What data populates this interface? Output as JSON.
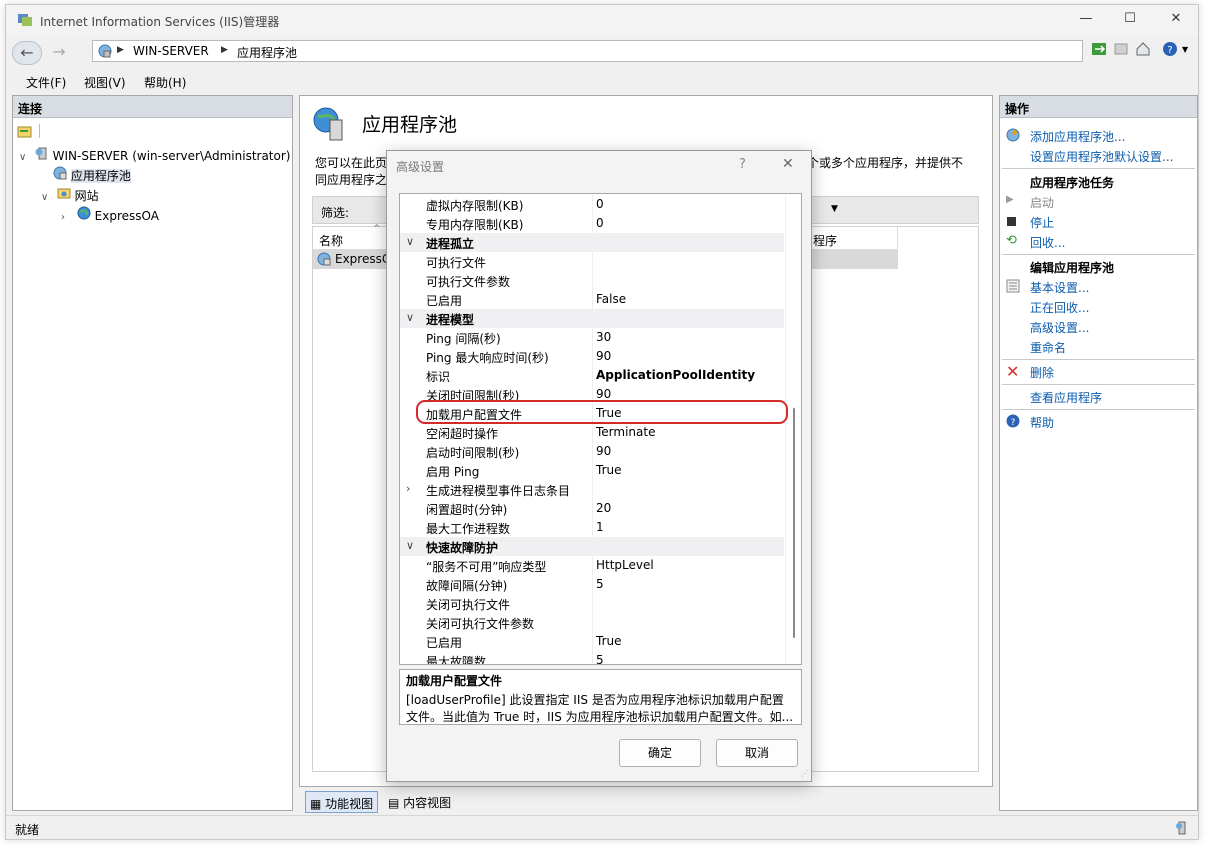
{
  "window": {
    "title": "Internet Information Services (IIS)管理器",
    "minimize": "—",
    "maximize": "☐",
    "close": "✕"
  },
  "address": {
    "segments": [
      "WIN-SERVER",
      "应用程序池"
    ]
  },
  "menu": [
    "文件(F)",
    "视图(V)",
    "帮助(H)"
  ],
  "connections": {
    "title": "连接",
    "tree": [
      {
        "label": "WIN-SERVER (win-server\\Administrator)",
        "toggle": "∨"
      },
      {
        "label": "应用程序池"
      },
      {
        "label": "网站",
        "toggle": "∨"
      },
      {
        "label": "ExpressOA",
        "toggle": "›"
      }
    ]
  },
  "main": {
    "title": "应用程序池",
    "desc_line1": "您可以在此页",
    "desc_line1_tail": "个或多个应用程序，并提供不",
    "desc_line2": "同应用程序之",
    "filter_label": "筛选:",
    "col_name": "名称",
    "col_app": "程序",
    "row_name": "ExpressC"
  },
  "bottom_tabs": [
    "功能视图",
    "内容视图"
  ],
  "actions": {
    "title": "操作",
    "add_pool": "添加应用程序池...",
    "set_defaults": "设置应用程序池默认设置...",
    "tasks_header": "应用程序池任务",
    "start": "启动",
    "stop": "停止",
    "recycle": "回收...",
    "edit_header": "编辑应用程序池",
    "basic": "基本设置...",
    "recycling": "正在回收...",
    "advanced": "高级设置...",
    "rename": "重命名",
    "delete": "删除",
    "view_apps": "查看应用程序",
    "help": "帮助"
  },
  "status": {
    "text": "就绪"
  },
  "dialog": {
    "title": "高级设置",
    "help": "?",
    "close": "✕",
    "rows": [
      {
        "name": "虚拟内存限制(KB)",
        "value": "0"
      },
      {
        "name": "专用内存限制(KB)",
        "value": "0"
      },
      {
        "name": "进程孤立",
        "value": "",
        "category": true,
        "glyph": "∨"
      },
      {
        "name": "可执行文件",
        "value": ""
      },
      {
        "name": "可执行文件参数",
        "value": ""
      },
      {
        "name": "已启用",
        "value": "False"
      },
      {
        "name": "进程模型",
        "value": "",
        "category": true,
        "glyph": "∨"
      },
      {
        "name": "Ping 间隔(秒)",
        "value": "30"
      },
      {
        "name": "Ping 最大响应时间(秒)",
        "value": "90"
      },
      {
        "name": "标识",
        "value": "ApplicationPoolIdentity",
        "bold": true
      },
      {
        "name": "关闭时间限制(秒)",
        "value": "90"
      },
      {
        "name": "加载用户配置文件",
        "value": "True",
        "highlight": true
      },
      {
        "name": "空闲超时操作",
        "value": "Terminate"
      },
      {
        "name": "启动时间限制(秒)",
        "value": "90"
      },
      {
        "name": "启用 Ping",
        "value": "True"
      },
      {
        "name": "生成进程模型事件日志条目",
        "value": "",
        "glyph": "›"
      },
      {
        "name": "闲置超时(分钟)",
        "value": "20"
      },
      {
        "name": "最大工作进程数",
        "value": "1"
      },
      {
        "name": "快速故障防护",
        "value": "",
        "category": true,
        "glyph": "∨"
      },
      {
        "name": "“服务不可用”响应类型",
        "value": "HttpLevel"
      },
      {
        "name": "故障间隔(分钟)",
        "value": "5"
      },
      {
        "name": "关闭可执行文件",
        "value": ""
      },
      {
        "name": "关闭可执行文件参数",
        "value": ""
      },
      {
        "name": "已启用",
        "value": "True"
      },
      {
        "name": "最大故障数",
        "value": "5"
      }
    ],
    "desc_title": "加载用户配置文件",
    "desc_line1": "[loadUserProfile] 此设置指定 IIS 是否为应用程序池标识加载用户配置",
    "desc_line2": "文件。当此值为 True 时，IIS 为应用程序池标识加载用户配置文件。如...",
    "ok": "确定",
    "cancel": "取消"
  },
  "colors": {
    "highlight_border": "#d42a2a",
    "link": "#0b5cad",
    "pane_header": "#d8dde4"
  }
}
